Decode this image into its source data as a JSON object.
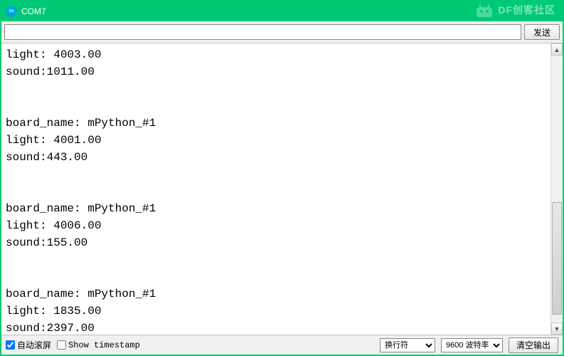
{
  "window": {
    "title": "COM7"
  },
  "watermark": {
    "text": "DF创客社区"
  },
  "input": {
    "value": "",
    "placeholder": ""
  },
  "buttons": {
    "send": "发送",
    "clear": "清空输出"
  },
  "console_lines": [
    "light: 4003.00",
    "sound:1011.00",
    "",
    "",
    "board_name: mPython_#1",
    "light: 4001.00",
    "sound:443.00",
    "",
    "",
    "board_name: mPython_#1",
    "light: 4006.00",
    "sound:155.00",
    "",
    "",
    "board_name: mPython_#1",
    "light: 1835.00",
    "sound:2397.00"
  ],
  "footer": {
    "autoscroll_label": "自动滚屏",
    "autoscroll_checked": true,
    "timestamp_label": "Show timestamp",
    "timestamp_checked": false,
    "line_ending_selected": "换行符",
    "baud_selected": "9600 波特率"
  }
}
